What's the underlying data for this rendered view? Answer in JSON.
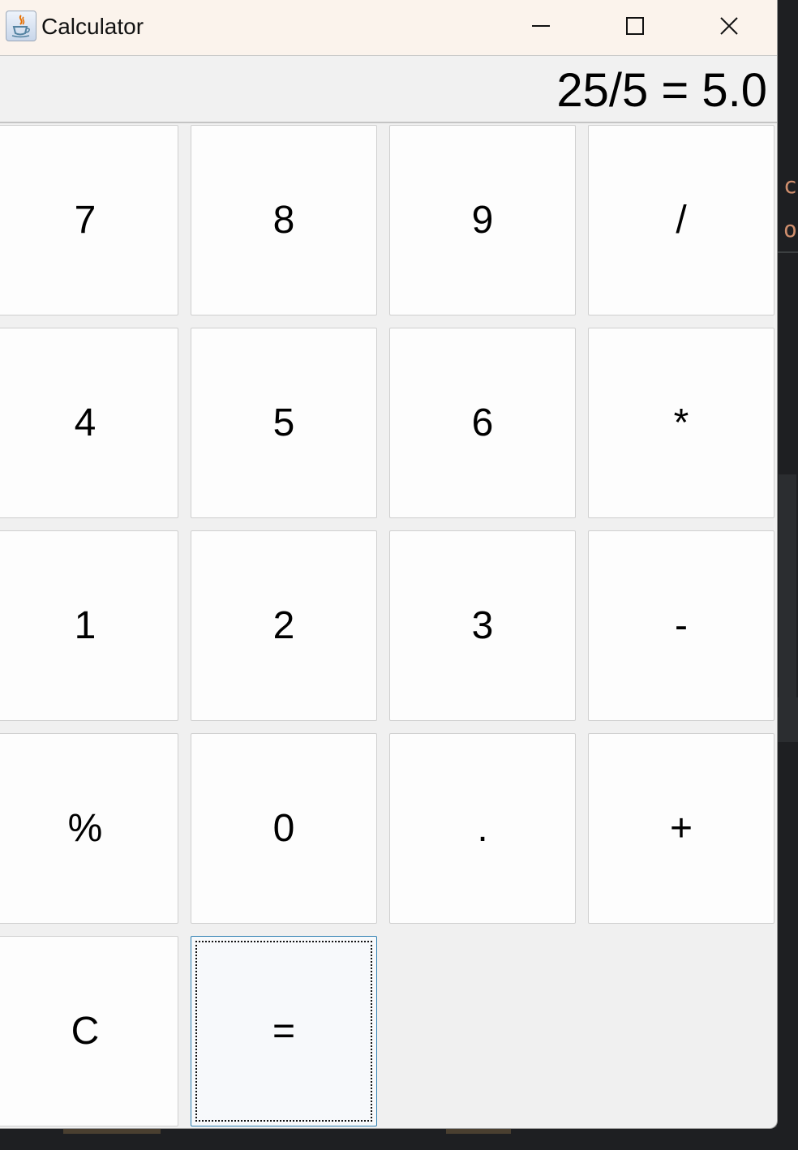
{
  "window": {
    "title": "Calculator",
    "icon": "java-cup-icon"
  },
  "display": {
    "text": "25/5 = 5.0"
  },
  "keys": {
    "k7": "7",
    "k8": "8",
    "k9": "9",
    "divide": "/",
    "k4": "4",
    "k5": "5",
    "k6": "6",
    "multiply": "*",
    "k1": "1",
    "k2": "2",
    "k3": "3",
    "subtract": "-",
    "percent": "%",
    "k0": "0",
    "decimal": ".",
    "add": "+",
    "clear": "C",
    "equals": "="
  },
  "background_editor": {
    "line1": "c",
    "line2": "ol"
  }
}
